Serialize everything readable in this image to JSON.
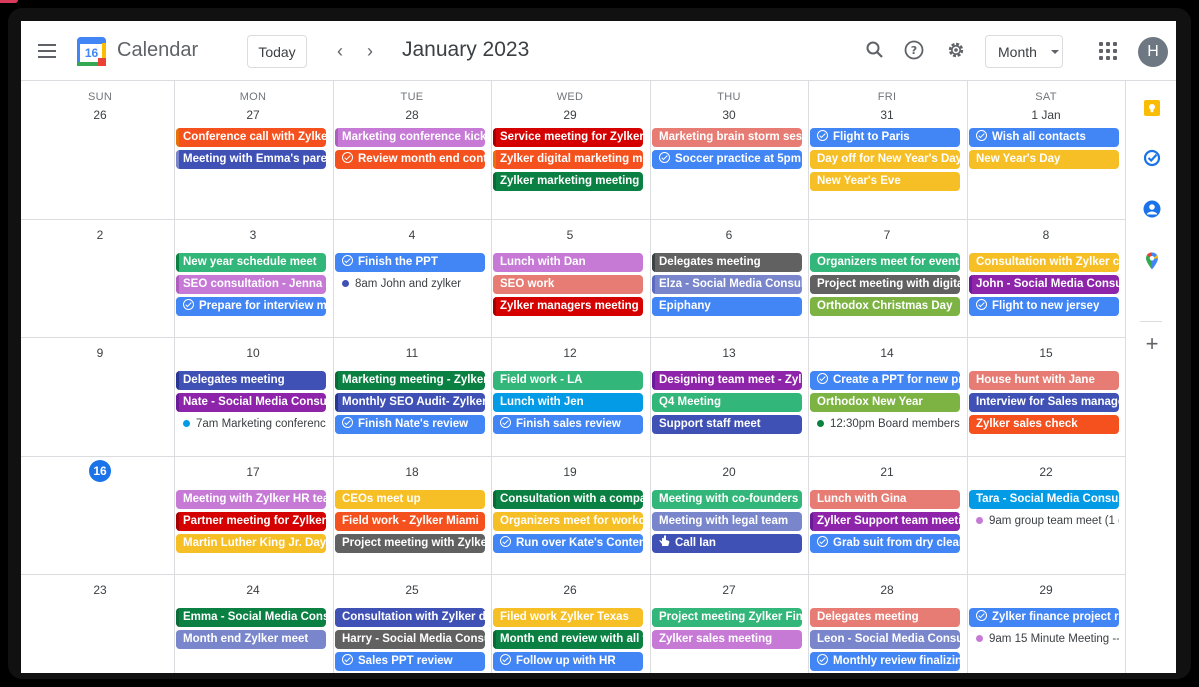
{
  "header": {
    "app_title": "Calendar",
    "logo_day": "16",
    "today_label": "Today",
    "prev_glyph": "‹",
    "next_glyph": "›",
    "month_title": "January 2023",
    "view_label": "Month",
    "avatar_initial": "H",
    "icons": [
      "search-icon",
      "help-icon",
      "settings-icon",
      "apps-grid-icon"
    ]
  },
  "colors": {
    "orange": "#f4511e",
    "purple": "#8e24aa",
    "lavender": "#d07bd9",
    "red": "#d50000",
    "salmon": "#e67c73",
    "blue": "#4285f4",
    "yellow": "#f6bf26",
    "green": "#33b679",
    "darkgreen": "#0b8043",
    "graphite": "#616161",
    "indigo": "#3f51b5",
    "peacock": "#039be5",
    "olive": "#7cb342",
    "today_blue": "#1a73e8"
  },
  "days_of_week": [
    "SUN",
    "MON",
    "TUE",
    "WED",
    "THU",
    "FRI",
    "SAT"
  ],
  "weeks": [
    {
      "days": [
        {
          "num": "26",
          "events": []
        },
        {
          "num": "27",
          "events": [
            {
              "text": "Conference call with Zylker",
              "color": "#f4511e",
              "bar": "#e8710a"
            },
            {
              "text": "Meeting with Emma's paren",
              "color": "#3f51b5",
              "bar": "#7986cb"
            }
          ]
        },
        {
          "num": "28",
          "events": [
            {
              "text": "Marketing conference kickc",
              "color": "#c67ad6",
              "bar": "#ad5ebf"
            },
            {
              "text": "Review month end conte",
              "color": "#f4511e",
              "bar": "#f4511e",
              "task": true
            }
          ]
        },
        {
          "num": "29",
          "events": [
            {
              "text": "Service meeting for Zylker f",
              "color": "#d50000",
              "bar": "#a50000"
            },
            {
              "text": "Zylker digital marketing mee",
              "color": "#f4511e",
              "bar": "#e8710a"
            },
            {
              "text": "Zylker marketing meeting",
              "color": "#0b8043",
              "bar": "#0a6b38"
            }
          ]
        },
        {
          "num": "30",
          "events": [
            {
              "text": "Marketing brain storm sessi",
              "color": "#e67c73",
              "bar": "#e67c73"
            },
            {
              "text": "Soccer practice at 5pm",
              "color": "#4285f4",
              "bar": "#4285f4",
              "task": true
            }
          ]
        },
        {
          "num": "31",
          "events": [
            {
              "text": "Flight to Paris",
              "color": "#4285f4",
              "bar": "#4285f4",
              "task": true
            },
            {
              "text": "Day off for New Year's Day",
              "color": "#f6bf26",
              "bar": "#f6bf26"
            },
            {
              "text": "New Year's Eve",
              "color": "#f6bf26",
              "bar": "#f6bf26"
            }
          ]
        },
        {
          "num": "1 Jan",
          "events": [
            {
              "text": "Wish all contacts",
              "color": "#4285f4",
              "bar": "#4285f4",
              "task": true
            },
            {
              "text": "New Year's Day",
              "color": "#f6bf26",
              "bar": "#f6bf26"
            }
          ]
        }
      ]
    },
    {
      "days": [
        {
          "num": "2",
          "events": []
        },
        {
          "num": "3",
          "events": [
            {
              "text": "New year schedule meet",
              "color": "#33b679",
              "bar": "#0b8043"
            },
            {
              "text": "SEO consultation - Jenna",
              "color": "#c67ad6",
              "bar": "#ad5ebf"
            },
            {
              "text": "Prepare for interview me",
              "color": "#4285f4",
              "bar": "#4285f4",
              "task": true
            }
          ]
        },
        {
          "num": "4",
          "events": [
            {
              "text": "Finish the PPT",
              "color": "#4285f4",
              "bar": "#4285f4",
              "task": true
            },
            {
              "dot": true,
              "dot_color": "#3f51b5",
              "time": "8am",
              "text": "John and zylker"
            }
          ]
        },
        {
          "num": "5",
          "events": [
            {
              "text": "Lunch with Dan",
              "color": "#c67ad6",
              "bar": "#c67ad6"
            },
            {
              "text": "SEO work",
              "color": "#e67c73",
              "bar": "#e67c73"
            },
            {
              "text": "Zylker managers meeting",
              "color": "#d50000",
              "bar": "#a50000"
            }
          ]
        },
        {
          "num": "6",
          "events": [
            {
              "text": "Delegates meeting",
              "color": "#616161",
              "bar": "#3c4043"
            },
            {
              "text": "Elza - Social Media Consulta",
              "color": "#7986cb",
              "bar": "#5c6bc0"
            },
            {
              "text": "Epiphany",
              "color": "#4285f4",
              "bar": "#4285f4"
            }
          ]
        },
        {
          "num": "7",
          "events": [
            {
              "text": "Organizers meet for event",
              "color": "#33b679",
              "bar": "#33b679"
            },
            {
              "text": "Project meeting with digital",
              "color": "#616161",
              "bar": "#616161"
            },
            {
              "text": "Orthodox Christmas Day",
              "color": "#7cb342",
              "bar": "#7cb342"
            }
          ]
        },
        {
          "num": "8",
          "events": [
            {
              "text": "Consultation with Zylker cor",
              "color": "#f6bf26",
              "bar": "#f6bf26"
            },
            {
              "text": "John - Social Media Consulta",
              "color": "#8e24aa",
              "bar": "#6a1b9a"
            },
            {
              "text": "Flight to new jersey",
              "color": "#4285f4",
              "bar": "#4285f4",
              "task": true
            }
          ]
        }
      ]
    },
    {
      "days": [
        {
          "num": "9",
          "events": []
        },
        {
          "num": "10",
          "events": [
            {
              "text": "Delegates meeting",
              "color": "#3f51b5",
              "bar": "#283593"
            },
            {
              "text": "Nate - Social Media Consult",
              "color": "#8e24aa",
              "bar": "#6a1b9a"
            },
            {
              "dot": true,
              "dot_color": "#039be5",
              "time": "7am",
              "text": "Marketing conference"
            }
          ]
        },
        {
          "num": "11",
          "events": [
            {
              "text": "Marketing meeting - Zylker",
              "color": "#0b8043",
              "bar": "#0a6b38"
            },
            {
              "text": "Monthly SEO Audit- Zylker",
              "color": "#3f51b5",
              "bar": "#283593"
            },
            {
              "text": "Finish Nate's review",
              "color": "#4285f4",
              "bar": "#4285f4",
              "task": true
            }
          ]
        },
        {
          "num": "12",
          "events": [
            {
              "text": "Field work - LA",
              "color": "#33b679",
              "bar": "#33b679"
            },
            {
              "text": "Lunch with Jen",
              "color": "#039be5",
              "bar": "#039be5"
            },
            {
              "text": "Finish sales review",
              "color": "#4285f4",
              "bar": "#4285f4",
              "task": true
            }
          ]
        },
        {
          "num": "13",
          "events": [
            {
              "text": "Designing team meet - Zylke",
              "color": "#8e24aa",
              "bar": "#6a1b9a"
            },
            {
              "text": "Q4 Meeting",
              "color": "#33b679",
              "bar": "#33b679"
            },
            {
              "text": "Support staff meet",
              "color": "#3f51b5",
              "bar": "#3f51b5"
            }
          ]
        },
        {
          "num": "14",
          "events": [
            {
              "text": "Create a PPT for new pro",
              "color": "#4285f4",
              "bar": "#4285f4",
              "task": true
            },
            {
              "text": "Orthodox New Year",
              "color": "#7cb342",
              "bar": "#7cb342"
            },
            {
              "dot": true,
              "dot_color": "#0b8043",
              "time": "12:30pm",
              "text": "Board members m"
            }
          ]
        },
        {
          "num": "15",
          "events": [
            {
              "text": "House hunt with Jane",
              "color": "#e67c73",
              "bar": "#e67c73"
            },
            {
              "text": "Interview for Sales manager",
              "color": "#3f51b5",
              "bar": "#3f51b5"
            },
            {
              "text": "Zylker sales check",
              "color": "#f4511e",
              "bar": "#f4511e"
            }
          ]
        }
      ]
    },
    {
      "days": [
        {
          "num": "16",
          "today": true,
          "events": []
        },
        {
          "num": "17",
          "events": [
            {
              "text": "Meeting with Zylker HR tean",
              "color": "#c67ad6",
              "bar": "#c67ad6"
            },
            {
              "text": "Partner meeting for Zylker U",
              "color": "#d50000",
              "bar": "#a50000"
            },
            {
              "text": "Martin Luther King Jr. Day",
              "color": "#f6bf26",
              "bar": "#f6bf26"
            }
          ]
        },
        {
          "num": "18",
          "events": [
            {
              "text": "CEOs meet up",
              "color": "#f6bf26",
              "bar": "#f6bf26"
            },
            {
              "text": "Field work - Zylker Miami",
              "color": "#f4511e",
              "bar": "#f4511e"
            },
            {
              "text": "Project meeting with Zylker",
              "color": "#616161",
              "bar": "#616161"
            }
          ]
        },
        {
          "num": "19",
          "events": [
            {
              "text": "Consultation with a compar",
              "color": "#0b8043",
              "bar": "#0a6b38"
            },
            {
              "text": "Organizers meet for workco",
              "color": "#f6bf26",
              "bar": "#f6bf26"
            },
            {
              "text": "Run over Kate's Content",
              "color": "#4285f4",
              "bar": "#4285f4",
              "task": true
            }
          ]
        },
        {
          "num": "20",
          "events": [
            {
              "text": "Meeting with co-founders",
              "color": "#33b679",
              "bar": "#33b679"
            },
            {
              "text": "Meeting with legal team",
              "color": "#7986cb",
              "bar": "#7986cb"
            },
            {
              "text": "Call Ian",
              "color": "#3f51b5",
              "bar": "#3f51b5",
              "hand": true
            }
          ]
        },
        {
          "num": "21",
          "events": [
            {
              "text": "Lunch with Gina",
              "color": "#e67c73",
              "bar": "#e67c73"
            },
            {
              "text": "Zylker Support team meetin",
              "color": "#8e24aa",
              "bar": "#6a1b9a"
            },
            {
              "text": "Grab suit from dry clean",
              "color": "#4285f4",
              "bar": "#4285f4",
              "task": true
            }
          ]
        },
        {
          "num": "22",
          "events": [
            {
              "text": "Tara - Social Media Consult",
              "color": "#039be5",
              "bar": "#039be5"
            },
            {
              "dot": true,
              "dot_color": "#c67ad6",
              "time": "9am",
              "text": "group team meet (1 c"
            }
          ]
        }
      ]
    },
    {
      "days": [
        {
          "num": "23",
          "events": []
        },
        {
          "num": "24",
          "events": [
            {
              "text": "Emma - Social Media Consu",
              "color": "#0b8043",
              "bar": "#0a6b38"
            },
            {
              "text": "Month end Zylker meet",
              "color": "#7986cb",
              "bar": "#7986cb"
            }
          ]
        },
        {
          "num": "25",
          "events": [
            {
              "text": "Consultation with Zylker de",
              "color": "#3f51b5",
              "bar": "#3f51b5"
            },
            {
              "text": "Harry - Social Media Consul",
              "color": "#616161",
              "bar": "#616161"
            },
            {
              "text": "Sales PPT review",
              "color": "#4285f4",
              "bar": "#4285f4",
              "task": true
            }
          ]
        },
        {
          "num": "26",
          "events": [
            {
              "text": "Filed work Zylker Texas",
              "color": "#f6bf26",
              "bar": "#f6bf26"
            },
            {
              "text": "Month end review with all te",
              "color": "#0b8043",
              "bar": "#0a6b38"
            },
            {
              "text": "Follow up with HR",
              "color": "#4285f4",
              "bar": "#4285f4",
              "task": true
            }
          ]
        },
        {
          "num": "27",
          "events": [
            {
              "text": "Project meeting Zylker Fina",
              "color": "#33b679",
              "bar": "#33b679"
            },
            {
              "text": "Zylker sales meeting",
              "color": "#c67ad6",
              "bar": "#c67ad6"
            }
          ]
        },
        {
          "num": "28",
          "events": [
            {
              "text": "Delegates meeting",
              "color": "#e67c73",
              "bar": "#e67c73"
            },
            {
              "text": "Leon - Social Media Consult",
              "color": "#7986cb",
              "bar": "#7986cb"
            },
            {
              "text": "Monthly review finalizing",
              "color": "#4285f4",
              "bar": "#4285f4",
              "task": true
            }
          ]
        },
        {
          "num": "29",
          "events": [
            {
              "text": "Zylker finance project re",
              "color": "#4285f4",
              "bar": "#4285f4",
              "task": true
            },
            {
              "dot": true,
              "dot_color": "#c67ad6",
              "time": "9am",
              "text": "15 Minute Meeting --"
            }
          ]
        }
      ]
    }
  ],
  "side_panel": {
    "icons": [
      "keep-icon",
      "tasks-icon",
      "contacts-icon",
      "maps-icon"
    ],
    "add_glyph": "+"
  }
}
